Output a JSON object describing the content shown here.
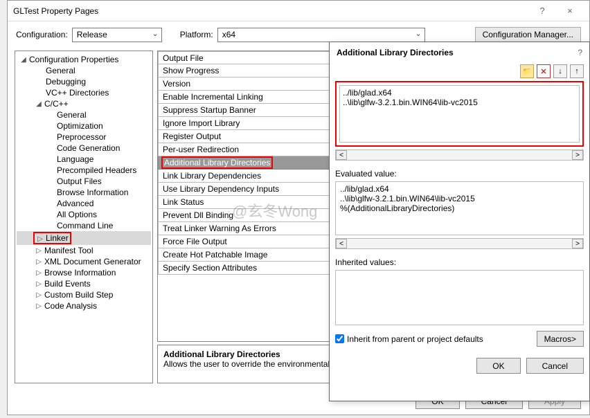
{
  "window": {
    "title": "GLTest Property Pages",
    "help": "?",
    "close": "×"
  },
  "top": {
    "config_label": "Configuration:",
    "config_value": "Release",
    "platform_label": "Platform:",
    "platform_value": "x64",
    "cfgmgr": "Configuration Manager..."
  },
  "tree": {
    "root": "Configuration Properties",
    "items1": [
      "General",
      "Debugging",
      "VC++ Directories"
    ],
    "cpp": "C/C++",
    "cpp_items": [
      "General",
      "Optimization",
      "Preprocessor",
      "Code Generation",
      "Language",
      "Precompiled Headers",
      "Output Files",
      "Browse Information",
      "Advanced",
      "All Options",
      "Command Line"
    ],
    "linker": "Linker",
    "after": [
      "Manifest Tool",
      "XML Document Generator",
      "Browse Information",
      "Build Events",
      "Custom Build Step",
      "Code Analysis"
    ]
  },
  "props": [
    "Output File",
    "Show Progress",
    "Version",
    "Enable Incremental Linking",
    "Suppress Startup Banner",
    "Ignore Import Library",
    "Register Output",
    "Per-user Redirection",
    "Additional Library Directories",
    "Link Library Dependencies",
    "Use Library Dependency Inputs",
    "Link Status",
    "Prevent Dll Binding",
    "Treat Linker Warning As Errors",
    "Force File Output",
    "Create Hot Patchable Image",
    "Specify Section Attributes"
  ],
  "selected_index": 8,
  "desc": {
    "title": "Additional Library Directories",
    "body": "Allows the user to override the environmental lib"
  },
  "buttons": {
    "ok": "OK",
    "cancel": "Cancel",
    "apply": "Apply"
  },
  "popup": {
    "title": "Additional Library Directories",
    "help": "?",
    "linesEdit": [
      "../lib/glad.x64",
      "..\\lib\\glfw-3.2.1.bin.WIN64\\lib-vc2015"
    ],
    "eval_label": "Evaluated value:",
    "eval_lines": [
      "../lib/glad.x64",
      "..\\lib\\glfw-3.2.1.bin.WIN64\\lib-vc2015",
      "%(AdditionalLibraryDirectories)"
    ],
    "inh_label": "Inherited values:",
    "inherit_cb": "Inherit from parent or project defaults",
    "macros": "Macros>",
    "ok": "OK",
    "cancel": "Cancel"
  },
  "watermark": "@玄冬Wong"
}
